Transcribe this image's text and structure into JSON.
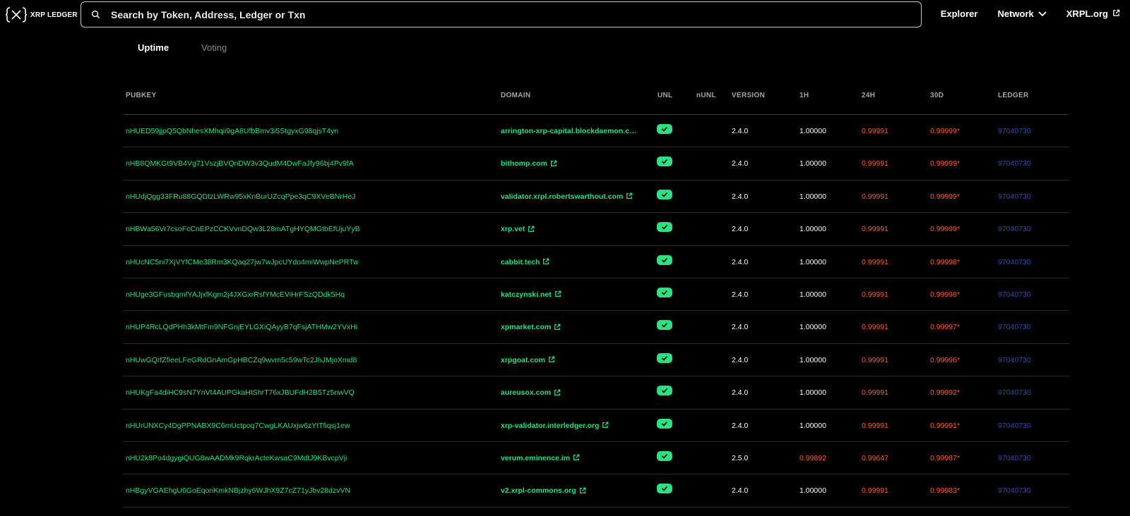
{
  "header": {
    "logo_text": "XRP LEDGER",
    "search_placeholder": "Search by Token, Address, Ledger or Txn",
    "nav": {
      "explorer": "Explorer",
      "network": "Network",
      "xrpl": "XRPL.org"
    }
  },
  "tabs": [
    {
      "label": "Uptime",
      "active": true
    },
    {
      "label": "Voting",
      "active": false
    }
  ],
  "table": {
    "headers": {
      "pubkey": "PUBKEY",
      "domain": "DOMAIN",
      "unl": "UNL",
      "nunl": "nUNL",
      "version": "VERSION",
      "h1": "1H",
      "h24": "24H",
      "d30": "30D",
      "ledger": "LEDGER"
    },
    "rows": [
      {
        "pubkey": "nHUED59jjpQ5QbNhesXMhqii9gA8UfbBmv3i5StgyxG98qjsT4yn",
        "domain": "arrington-xrp-capital.blockdaemon.com",
        "ext": false,
        "unl": true,
        "version": "2.4.0",
        "h1": "1.00000",
        "h24": "0.99991",
        "d30": "0.99999*",
        "ledger": "97040730"
      },
      {
        "pubkey": "nHB8QMKGt9VB4Vg71VszjBVQnDW3v3QudM4DwFaJfy96bj4Pv9fA",
        "domain": "bithomp.com",
        "ext": true,
        "unl": true,
        "version": "2.4.0",
        "h1": "1.00000",
        "h24": "0.99991",
        "d30": "0.99999*",
        "ledger": "97040730"
      },
      {
        "pubkey": "nHUdjQgg33FRu88GQDtzLWRw95xKnBurUZcqPpe3qC9XVeBNrHeJ",
        "domain": "validator.xrpl.robertswarthout.com",
        "ext": true,
        "unl": true,
        "version": "2.4.0",
        "h1": "1.00000",
        "h24": "0.99991",
        "d30": "0.99999*",
        "ledger": "97040730"
      },
      {
        "pubkey": "nHBWa56Vr7csoFcCnEPzCCKVvnDQw3L28mATgHYQMGtbEfUjuYyB",
        "domain": "xrp.vet",
        "ext": true,
        "unl": true,
        "version": "2.4.0",
        "h1": "1.00000",
        "h24": "0.99991",
        "d30": "0.99999*",
        "ledger": "97040730"
      },
      {
        "pubkey": "nHUcNC5ni7XjVYfCMe38Rm3KQaq27jw7wJpcUYdo4miWwpNePRTw",
        "domain": "cabbit.tech",
        "ext": true,
        "unl": true,
        "version": "2.4.0",
        "h1": "1.00000",
        "h24": "0.99991",
        "d30": "0.99998*",
        "ledger": "97040730"
      },
      {
        "pubkey": "nHUge3GFusbqmfYAJjxfKgm2j4JXGxrRsfYMcEViHrFSzQDdk5Hq",
        "domain": "katczynski.net",
        "ext": true,
        "unl": true,
        "version": "2.4.0",
        "h1": "1.00000",
        "h24": "0.99991",
        "d30": "0.99998*",
        "ledger": "97040730"
      },
      {
        "pubkey": "nHUP4RcLQdPHh3kMtFm9NFGnjEYLGXiQAyyB7qFsjATHMw2YVxHi",
        "domain": "xpmarket.com",
        "ext": true,
        "unl": true,
        "version": "2.4.0",
        "h1": "1.00000",
        "h24": "0.99991",
        "d30": "0.99997*",
        "ledger": "97040730"
      },
      {
        "pubkey": "nHUwGQrfZfieeLFeGRdGnAmGpHBCZq9wvm5c59wTc2JhJMjoXmd8",
        "domain": "xrpgoat.com",
        "ext": true,
        "unl": true,
        "version": "2.4.0",
        "h1": "1.00000",
        "h24": "0.99991",
        "d30": "0.99996*",
        "ledger": "97040730"
      },
      {
        "pubkey": "nHUKgFa4diHC9sN7YnVt4AUPGkaHtShrT76xJBUFdH2B5Tz5nwVQ",
        "domain": "aureusox.com",
        "ext": true,
        "unl": true,
        "version": "2.4.0",
        "h1": "1.00000",
        "h24": "0.99991",
        "d30": "0.99992*",
        "ledger": "97040730"
      },
      {
        "pubkey": "nHUrUNXCy4DgPPNABX9C6mUctpoq7CwgLKAUxjw6zYtTfiqsj1ew",
        "domain": "xrp-validator.interledger.org",
        "ext": true,
        "unl": true,
        "version": "2.4.0",
        "h1": "1.00000",
        "h24": "0.99991",
        "d30": "0.99991*",
        "ledger": "97040730"
      },
      {
        "pubkey": "nHU2k8Po4dgygiQUG8wAADMk9RqkrActeKwsaC9MdtJ9KBvcpVji",
        "domain": "verum.eminence.im",
        "ext": true,
        "unl": true,
        "version": "2.5.0",
        "h1": "0.99892",
        "h24": "0.99647",
        "d30": "0.99987*",
        "ledger": "97040730"
      },
      {
        "pubkey": "nHBgyVGAEhgU6GoEqoriKmkNBjzhy6WJhX9Z7cZ71yJbv28dzvVN",
        "domain": "v2.xrpl-commons.org",
        "ext": true,
        "unl": true,
        "version": "2.4.0",
        "h1": "1.00000",
        "h24": "0.99991",
        "d30": "0.99983*",
        "ledger": "97040730"
      }
    ]
  },
  "colors": {
    "accent_green": "#2ee07f",
    "warn_red": "#ff5a3a",
    "ledger_blue": "#2f4fa8"
  }
}
